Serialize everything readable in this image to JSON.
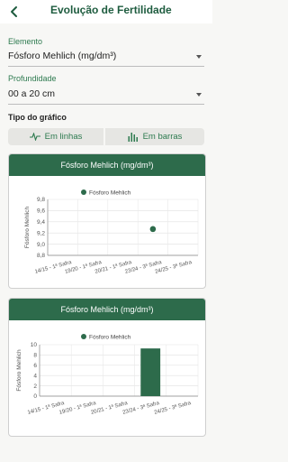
{
  "header": {
    "title": "Evolução de Fertilidade",
    "back_icon": "arrow-left-icon"
  },
  "form": {
    "element_label": "Elemento",
    "element_value": "Fósforo Mehlich (mg/dm³)",
    "depth_label": "Profundidade",
    "depth_value": "00 a 20 cm",
    "chart_type_label": "Tipo do gráfico",
    "toggle_lines_label": "Em linhas",
    "toggle_bars_label": "Em barras"
  },
  "colors": {
    "primary": "#2d6b4b",
    "accent": "#1e5c3f"
  },
  "chart_data": [
    {
      "type": "scatter",
      "title": "Fósforo Mehlich (mg/dm³)",
      "ylabel": "Fósforo Mehlich",
      "legend": "top-center",
      "categories": [
        "14/15 - 1ª Safra",
        "19/20 - 1ª Safra",
        "20/21 - 1ª Safra",
        "23/24 - 3ª Safra",
        "24/25 - 3ª Safra"
      ],
      "series": [
        {
          "name": "Fósforo Mehlich",
          "values": [
            null,
            null,
            null,
            9.27,
            null
          ]
        }
      ],
      "yticks": [
        "9,8",
        "9,6",
        "9,4",
        "9,2",
        "9,0",
        "8,8"
      ],
      "ylim": [
        8.8,
        9.8
      ]
    },
    {
      "type": "bar",
      "title": "Fósforo Mehlich (mg/dm³)",
      "ylabel": "Fósforo Mehlich",
      "legend": "top-center",
      "categories": [
        "14/15 - 1ª Safra",
        "19/20 - 1ª Safra",
        "20/21 - 1ª Safra",
        "23/24 - 3ª Safra",
        "24/25 - 3ª Safra"
      ],
      "series": [
        {
          "name": "Fósforo Mehlich",
          "values": [
            0,
            0,
            0,
            9.27,
            0
          ]
        }
      ],
      "yticks": [
        "10",
        "8",
        "6",
        "4",
        "2",
        "0"
      ],
      "ylim": [
        0,
        10
      ]
    }
  ]
}
